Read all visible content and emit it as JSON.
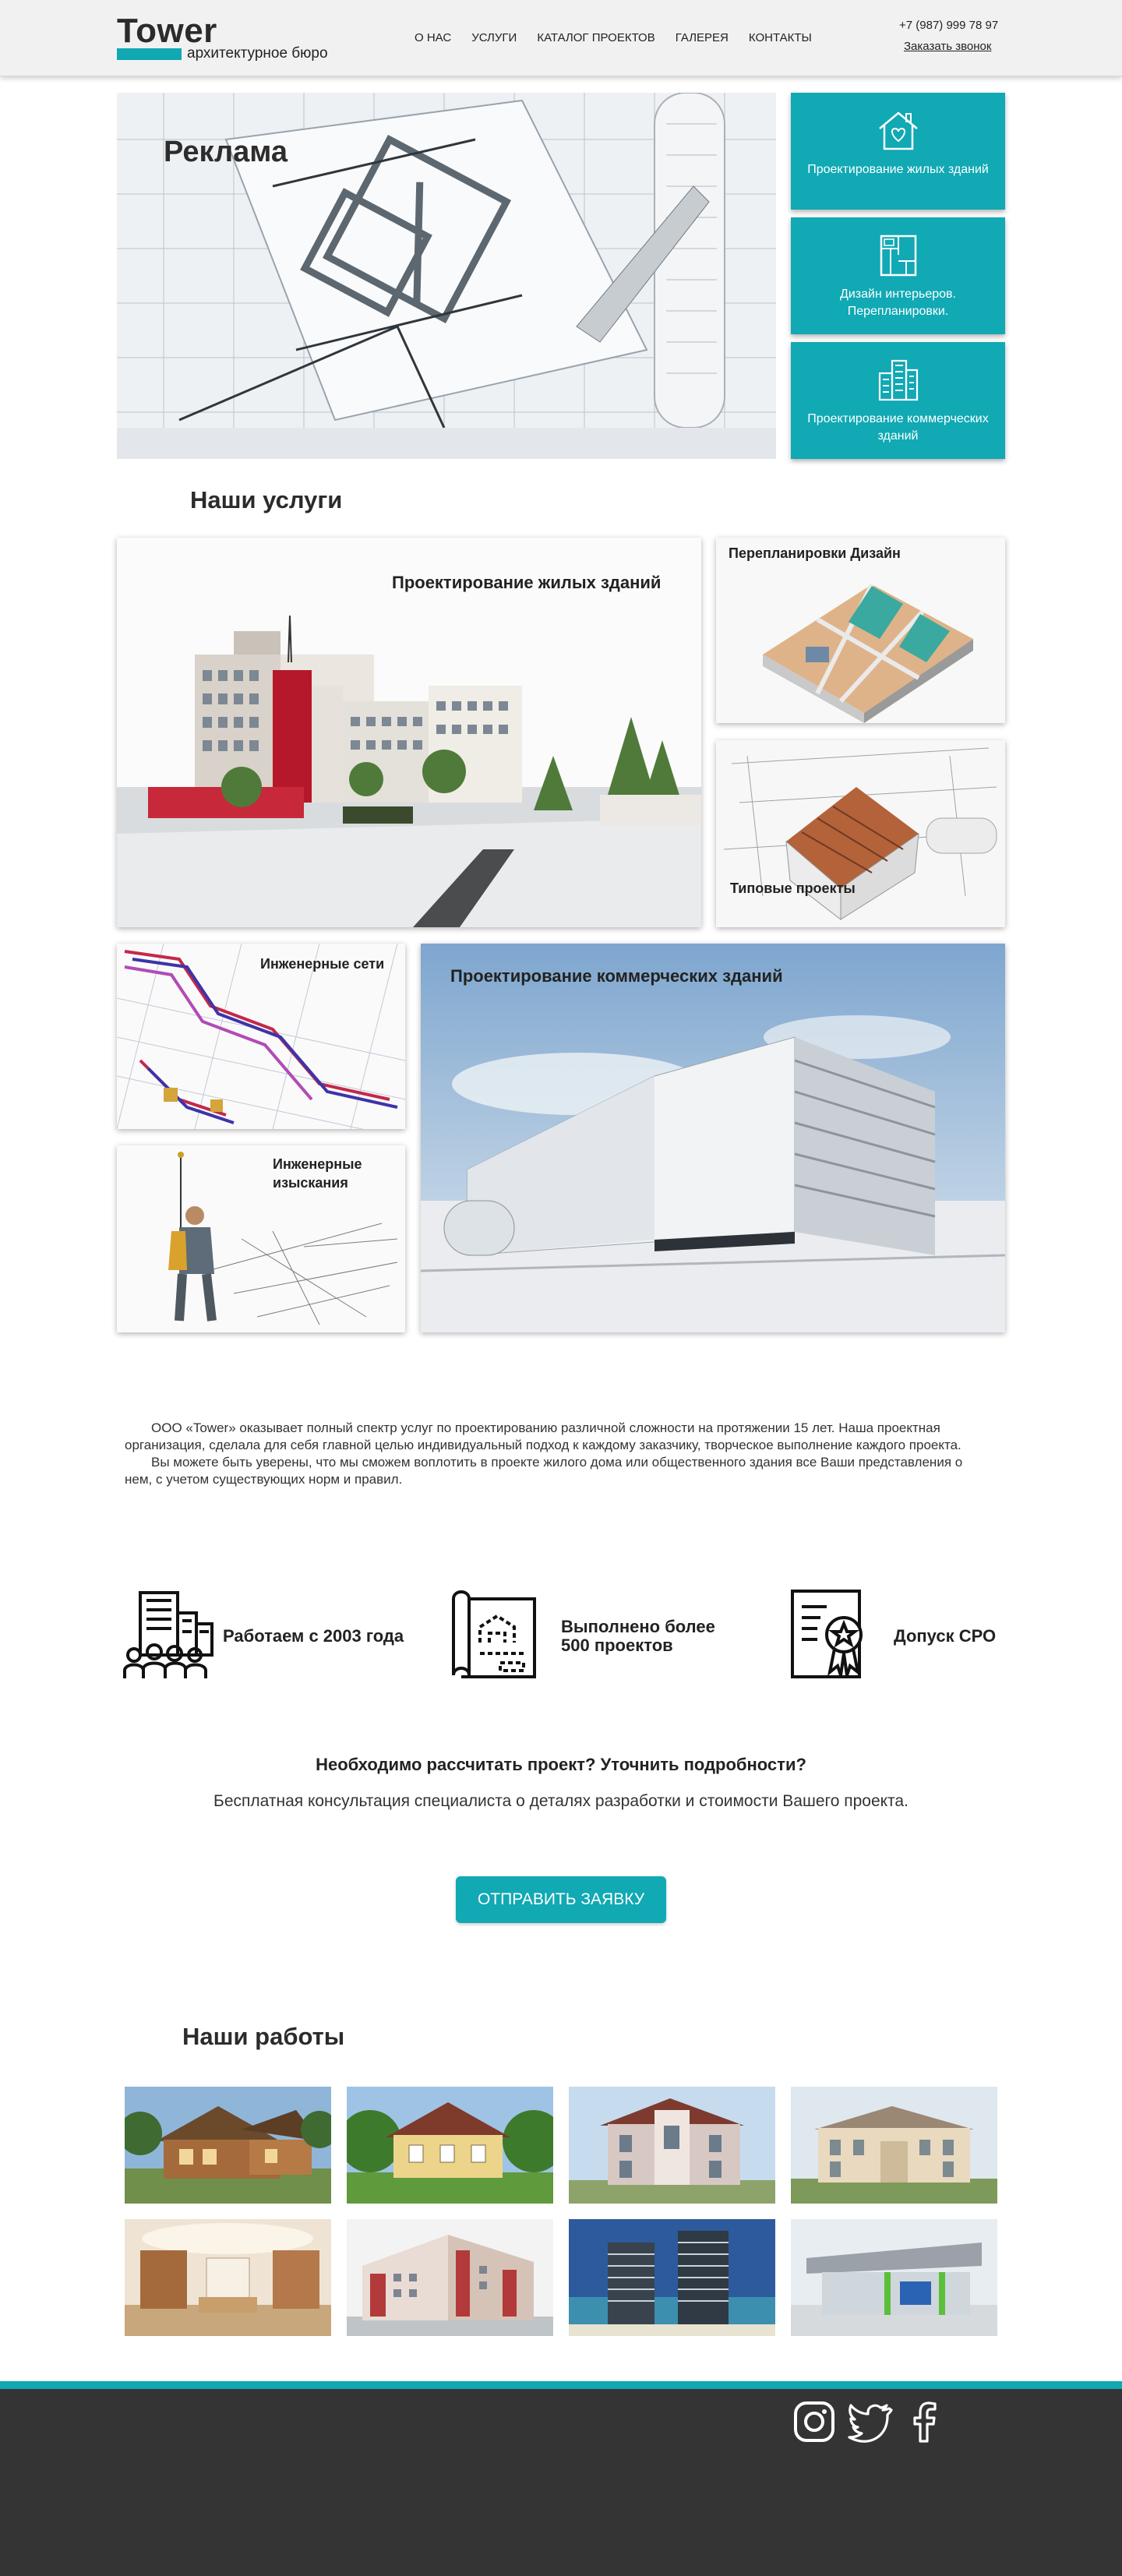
{
  "header": {
    "logo_title": "Tower",
    "logo_subtitle": "архитектурное бюро",
    "nav": [
      "О НАС",
      "УСЛУГИ",
      "КАТАЛОГ ПРОЕКТОВ",
      "ГАЛЕРЕЯ",
      "КОНТАКТЫ"
    ],
    "phone": "+7 (987) 999 78 97",
    "callback": "Заказать звонок"
  },
  "hero": {
    "ad_label": "Реклама",
    "tiles": [
      {
        "title": "Проектирование жилых зданий",
        "icon": "house-heart-icon"
      },
      {
        "title": "Дизайн интерьеров. Перепланировки.",
        "icon": "floor-plan-icon"
      },
      {
        "title": "Проектирование коммерческих зданий",
        "icon": "office-buildings-icon"
      }
    ]
  },
  "services": {
    "title": "Наши услуги",
    "cards": {
      "residential": "Проектирование жилых зданий",
      "redevelopment": "Перепланировки Дизайн",
      "typical": "Типовые проекты",
      "networks": "Инженерные сети",
      "surveys": "Инженерные изыскания",
      "commercial": "Проектирование коммерческих зданий"
    }
  },
  "about": {
    "p1": "ООО «Tower» оказывает полный спектр услуг по проектированию различной сложности на протяжении 15 лет. Наша проектная организация, сделала для себя главной целью индивидуальный подход к каждому заказчику, творческое выполнение каждого проекта.",
    "p2": "Вы можете быть уверены, что мы сможем воплотить в проекте жилого дома или общественного здания все Ваши представления о нем, с учетом существующих норм и правил."
  },
  "features": [
    {
      "text": "Работаем с 2003 года",
      "icon": "company-building-icon"
    },
    {
      "text": "Выполнено более 500 проектов",
      "icon": "blueprint-scroll-icon"
    },
    {
      "text": "Допуск СРО",
      "icon": "certificate-icon"
    }
  ],
  "cta": {
    "question": "Необходимо рассчитать проект? Уточнить подробности?",
    "subtitle": "Бесплатная консультация специалиста о деталях разработки и стоимости Вашего проекта.",
    "button": "ОТПРАВИТЬ ЗАЯВКУ"
  },
  "works": {
    "title": "Наши работы"
  },
  "footer": {
    "social": [
      "instagram-icon",
      "twitter-icon",
      "facebook-icon"
    ]
  },
  "colors": {
    "accent": "#10a9b4",
    "footer": "#343434",
    "header": "#f1f1f1"
  }
}
